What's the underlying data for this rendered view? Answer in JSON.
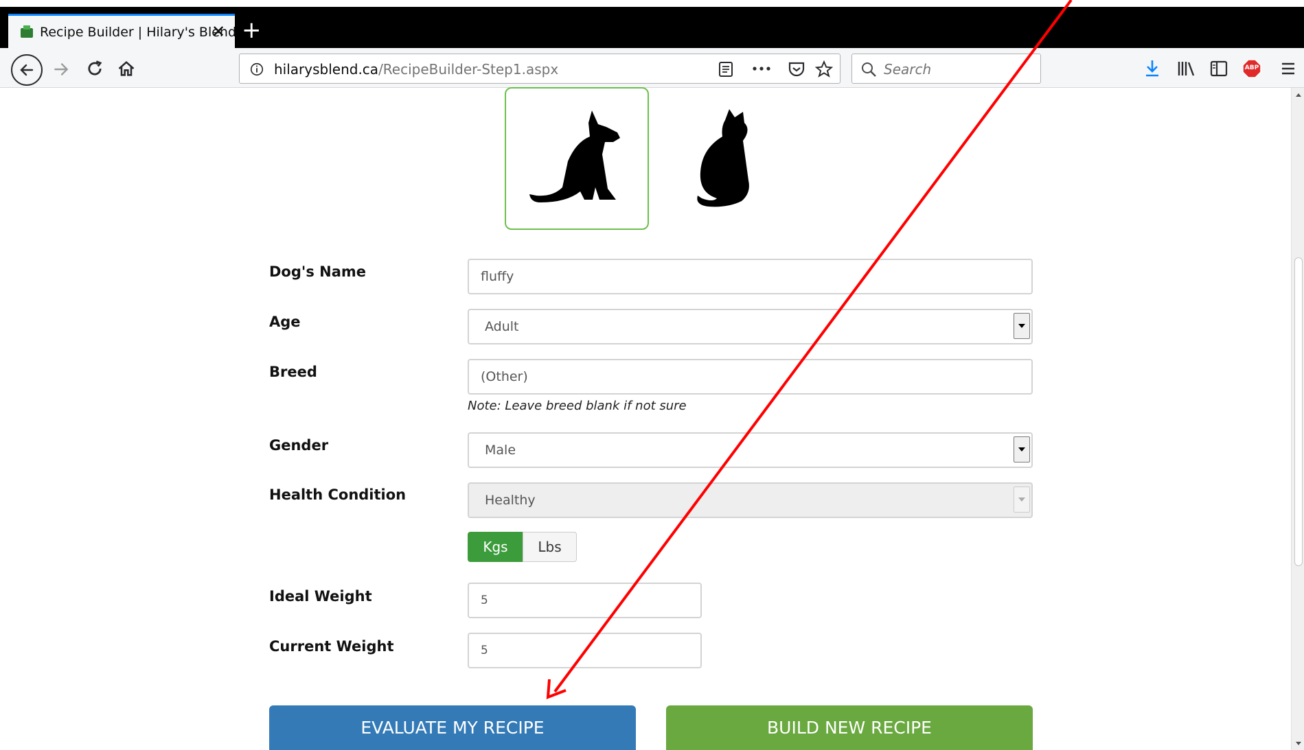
{
  "browser": {
    "tab_title": "Recipe Builder | Hilary's Blend",
    "url_host": "hilarysblend.ca",
    "url_path": "/RecipeBuilder-Step1.aspx",
    "search_placeholder": "Search",
    "abp_badge": "ABP"
  },
  "form": {
    "name_label": "Dog's Name",
    "name_value": "fluffy",
    "age_label": "Age",
    "age_value": "Adult",
    "breed_label": "Breed",
    "breed_value": "(Other)",
    "breed_note": "Note: Leave breed blank if not sure",
    "gender_label": "Gender",
    "gender_value": "Male",
    "health_label": "Health Condition",
    "health_value": "Healthy",
    "unit_kgs": "Kgs",
    "unit_lbs": "Lbs",
    "ideal_weight_label": "Ideal Weight",
    "ideal_weight_value": "5",
    "current_weight_label": "Current Weight",
    "current_weight_value": "5"
  },
  "actions": {
    "evaluate_label": "EVALUATE MY RECIPE",
    "build_label": "BUILD NEW RECIPE"
  },
  "colors": {
    "accent_green": "#6aa840",
    "selected_unit": "#3c9c3c",
    "evaluate_blue": "#337ab7",
    "annotation_red": "#ff0000"
  }
}
